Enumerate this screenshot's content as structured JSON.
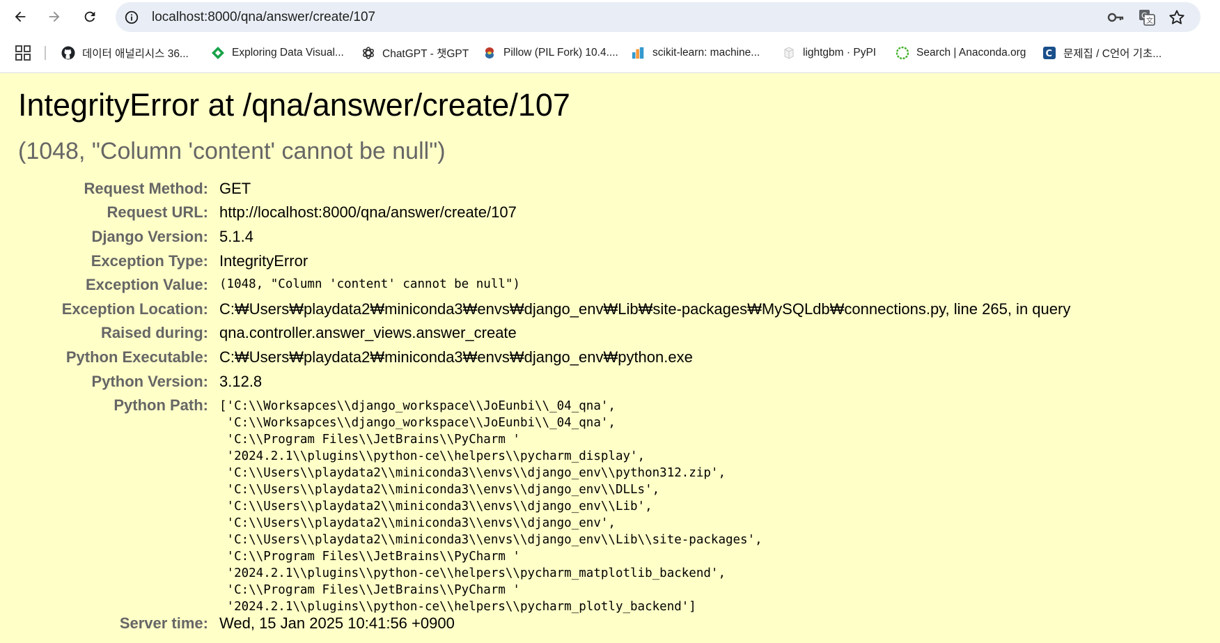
{
  "browser": {
    "url": "localhost:8000/qna/answer/create/107",
    "bookmarks": [
      {
        "label": "데이터 애널리시스 36...",
        "icon": "github-icon"
      },
      {
        "label": "Exploring Data Visual...",
        "icon": "diamond-favicon-icon"
      },
      {
        "label": "ChatGPT - 챗GPT",
        "icon": "openai-icon"
      },
      {
        "label": "Pillow (PIL Fork) 10.4....",
        "icon": "pillow-icon"
      },
      {
        "label": "scikit-learn: machine...",
        "icon": "scikit-learn-icon"
      },
      {
        "label": "lightgbm · PyPI",
        "icon": "pypi-icon"
      },
      {
        "label": "Search | Anaconda.org",
        "icon": "anaconda-icon"
      },
      {
        "label": "문제집 / C언어 기초...",
        "icon": "codeup-icon"
      }
    ]
  },
  "error": {
    "title": "IntegrityError at /qna/answer/create/107",
    "value": "(1048, \"Column 'content' cannot be null\")"
  },
  "meta": {
    "request_method": {
      "label": "Request Method:",
      "value": "GET"
    },
    "request_url": {
      "label": "Request URL:",
      "value": "http://localhost:8000/qna/answer/create/107"
    },
    "django_version": {
      "label": "Django Version:",
      "value": "5.1.4"
    },
    "exception_type": {
      "label": "Exception Type:",
      "value": "IntegrityError"
    },
    "exception_value": {
      "label": "Exception Value:",
      "value": "(1048, \"Column 'content' cannot be null\")"
    },
    "exception_location": {
      "label": "Exception Location:",
      "value": "C:₩Users₩playdata2₩miniconda3₩envs₩django_env₩Lib₩site-packages₩MySQLdb₩connections.py, line 265, in query"
    },
    "raised_during": {
      "label": "Raised during:",
      "value": "qna.controller.answer_views.answer_create"
    },
    "python_executable": {
      "label": "Python Executable:",
      "value": "C:₩Users₩playdata2₩miniconda3₩envs₩django_env₩python.exe"
    },
    "python_version": {
      "label": "Python Version:",
      "value": "3.12.8"
    },
    "python_path": {
      "label": "Python Path:",
      "lines": [
        "['C:\\\\Worksapces\\\\django_workspace\\\\JoEunbi\\\\_04_qna',",
        " 'C:\\\\Worksapces\\\\django_workspace\\\\JoEunbi\\\\_04_qna',",
        " 'C:\\\\Program Files\\\\JetBrains\\\\PyCharm '",
        " '2024.2.1\\\\plugins\\\\python-ce\\\\helpers\\\\pycharm_display',",
        " 'C:\\\\Users\\\\playdata2\\\\miniconda3\\\\envs\\\\django_env\\\\python312.zip',",
        " 'C:\\\\Users\\\\playdata2\\\\miniconda3\\\\envs\\\\django_env\\\\DLLs',",
        " 'C:\\\\Users\\\\playdata2\\\\miniconda3\\\\envs\\\\django_env\\\\Lib',",
        " 'C:\\\\Users\\\\playdata2\\\\miniconda3\\\\envs\\\\django_env',",
        " 'C:\\\\Users\\\\playdata2\\\\miniconda3\\\\envs\\\\django_env\\\\Lib\\\\site-packages',",
        " 'C:\\\\Program Files\\\\JetBrains\\\\PyCharm '",
        " '2024.2.1\\\\plugins\\\\python-ce\\\\helpers\\\\pycharm_matplotlib_backend',",
        " 'C:\\\\Program Files\\\\JetBrains\\\\PyCharm '",
        " '2024.2.1\\\\plugins\\\\python-ce\\\\helpers\\\\pycharm_plotly_backend']"
      ]
    },
    "server_time": {
      "label": "Server time:",
      "value": "Wed, 15 Jan 2025 10:41:56 +0900"
    }
  },
  "colors": {
    "page_background": "#ffffc8",
    "label_gray": "#666666",
    "omnibox": "#e9eef6"
  }
}
